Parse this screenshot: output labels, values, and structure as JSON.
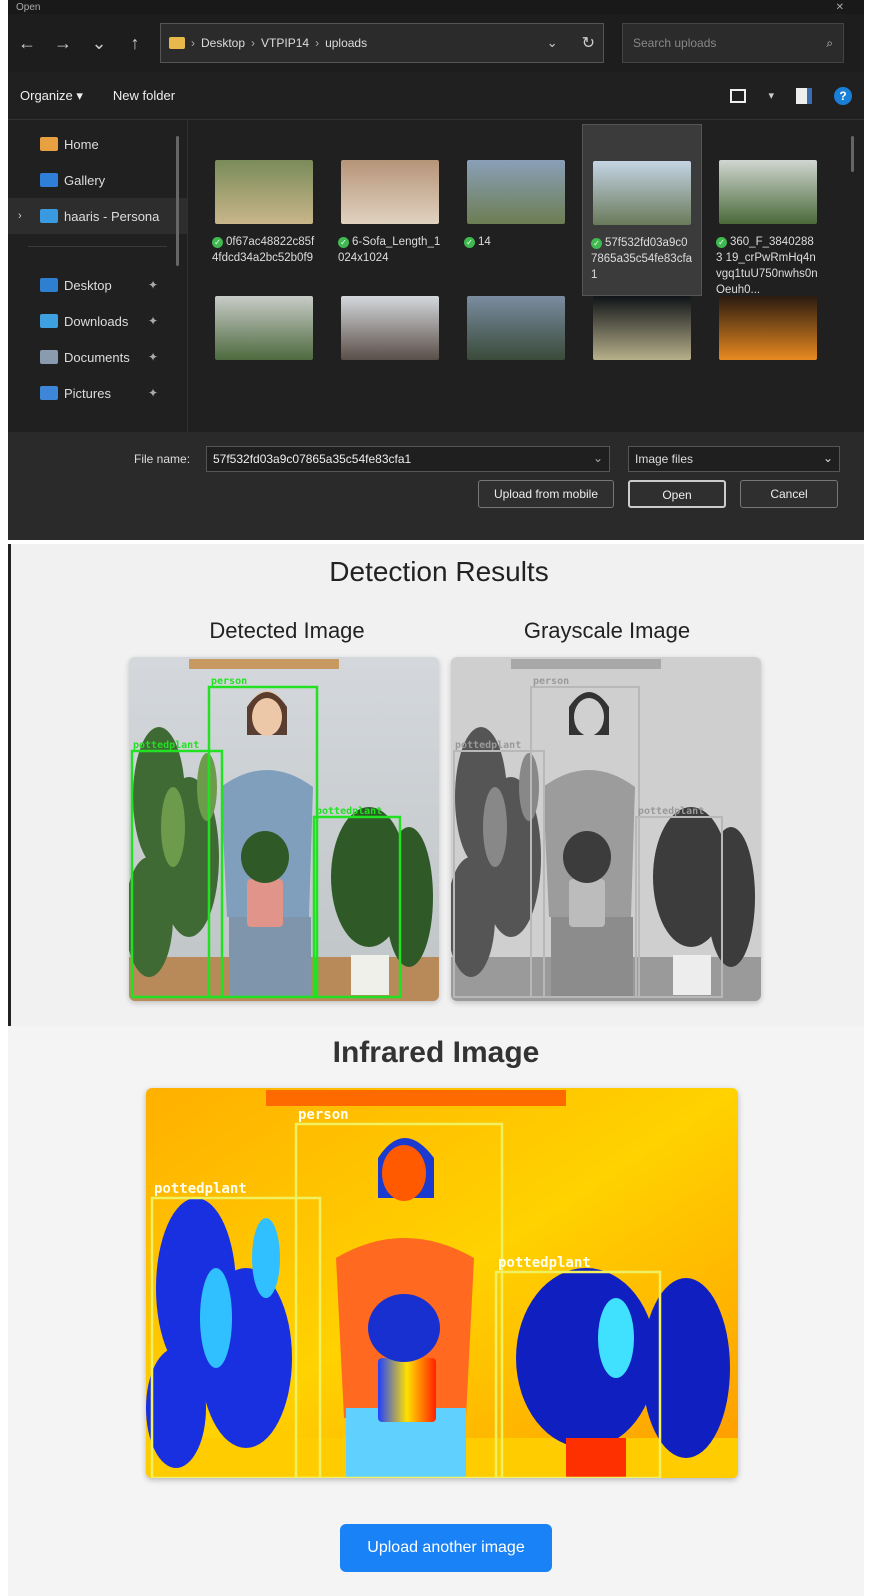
{
  "dialog": {
    "title": "Open",
    "nav": {
      "back": "←",
      "forward": "→",
      "recent": "⌄",
      "up": "↑"
    },
    "breadcrumb": [
      "Desktop",
      "VTPIP14",
      "uploads"
    ],
    "search_placeholder": "Search uploads",
    "commands": {
      "organize": "Organize ▾",
      "new_folder": "New folder"
    },
    "sidebar": [
      {
        "label": "Home",
        "color": "#e8a040"
      },
      {
        "label": "Gallery",
        "color": "#2f7fd8"
      },
      {
        "label": "haaris - Persona",
        "color": "#3a9ae0",
        "selected": true
      },
      {
        "label": "Desktop",
        "color": "#2e7fd0"
      },
      {
        "label": "Downloads",
        "color": "#3fa0e0"
      },
      {
        "label": "Documents",
        "color": "#8a9bb0"
      },
      {
        "label": "Pictures",
        "color": "#3d86d8"
      }
    ],
    "files_row1": [
      {
        "name": "0f67ac48822c85f4fdcd34a2bc52b0f9",
        "thumb": [
          "#7a8b5a",
          "#c9b68a"
        ]
      },
      {
        "name": "6-Sofa_Length_1024x1024",
        "thumb": [
          "#b69478",
          "#e0d2c0"
        ]
      },
      {
        "name": "14",
        "thumb": [
          "#8aa0b8",
          "#6c7d52"
        ]
      },
      {
        "name": "57f532fd03a9c07865a35c54fe83cfa1",
        "thumb": [
          "#c4d4e4",
          "#6a7a5a"
        ],
        "selected": true
      },
      {
        "name": "360_F_38402883 19_crPwRmHq4nvgq1tuU750nwhs0nOeuh0...",
        "thumb": [
          "#d0d6d0",
          "#4a6a3a"
        ]
      }
    ],
    "files_row2": [
      {
        "thumb": [
          "#c8ccc8",
          "#4e6a3e"
        ]
      },
      {
        "thumb": [
          "#d4d8dc",
          "#5a4e48"
        ]
      },
      {
        "thumb": [
          "#7a8ca0",
          "#3a4a3a"
        ]
      },
      {
        "thumb": [
          "#101418",
          "#b8b08a"
        ]
      },
      {
        "thumb": [
          "#2a1a10",
          "#e88a20"
        ]
      }
    ],
    "file_name_label": "File name:",
    "file_name_value": "57f532fd03a9c07865a35c54fe83cfa1",
    "file_type": "Image files",
    "buttons": {
      "upload": "Upload from mobile",
      "open": "Open",
      "cancel": "Cancel"
    }
  },
  "results": {
    "title": "Detection Results",
    "detected_title": "Detected Image",
    "grayscale_title": "Grayscale Image",
    "labels": {
      "person": "person",
      "plant": "pottedplant"
    }
  },
  "infrared": {
    "title": "Infrared Image",
    "button": "Upload another image"
  }
}
